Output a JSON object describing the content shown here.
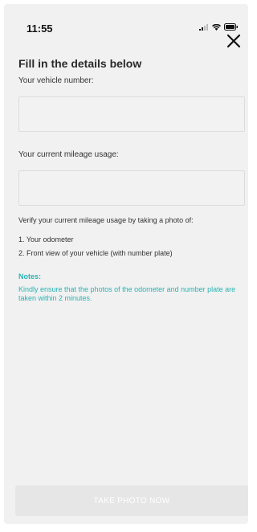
{
  "status_bar": {
    "time": "11:55",
    "icons": [
      "signal-icon",
      "wifi-icon",
      "battery-icon"
    ]
  },
  "header": {
    "close_icon": "close-icon"
  },
  "form": {
    "title": "Fill in the details below",
    "vehicle_number_label": "Your vehicle number:",
    "vehicle_number_value": "",
    "mileage_label": "Your current mileage usage:",
    "mileage_value": "",
    "verify_text": "Verify your current mileage usage by taking a photo of:",
    "steps": [
      "1. Your odometer",
      "2. Front view of your vehicle (with number plate)"
    ],
    "notes_title": "Notes:",
    "notes_text": "Kindly ensure that the photos of the odometer and number plate are taken within 2 minutes."
  },
  "action": {
    "button_label": "TAKE PHOTO NOW"
  },
  "colors": {
    "accent": "#2ab3b3",
    "background": "#f1f1f1",
    "button_disabled": "#e6e6e6"
  }
}
